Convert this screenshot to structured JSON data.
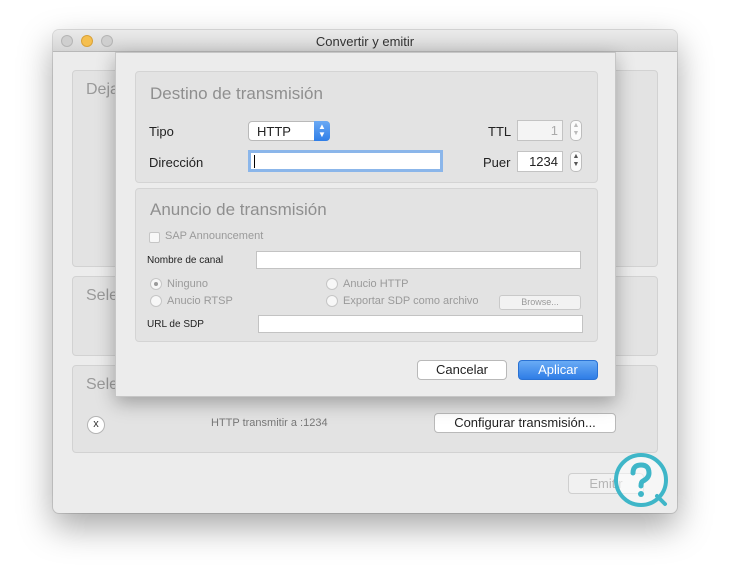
{
  "window": {
    "title": "Convertir y emitir",
    "groups": [
      "Deja",
      "Sele",
      "Sele"
    ],
    "stream_status": "HTTP transmitir a :1234",
    "configure_label": "Configurar transmisión...",
    "remove_label": "x",
    "emit_label": "Emitir"
  },
  "dialog": {
    "destination": {
      "title": "Destino de transmisión",
      "type_label": "Tipo",
      "type_value": "HTTP",
      "address_label": "Dirección",
      "address_value": "",
      "ttl_label": "TTL",
      "ttl_value": "1",
      "port_label": "Puer",
      "port_value": "1234"
    },
    "announce": {
      "title": "Anuncio de transmisión",
      "sap_label": "SAP Announcement",
      "sap_checked": false,
      "channel_label": "Nombre de canal",
      "channel_value": "",
      "options": [
        "Ninguno",
        "Anucio HTTP",
        "Anucio RTSP",
        "Exportar SDP como archivo"
      ],
      "selected_option": "Ninguno",
      "browse_label": "Browse...",
      "sdp_url_label": "URL de SDP",
      "sdp_url_value": ""
    },
    "cancel_label": "Cancelar",
    "apply_label": "Aplicar"
  },
  "colors": {
    "accent": "#2f7de6",
    "focus_ring": "#8bb6ea",
    "minimize": "#f5bf4f",
    "watermark": "#3fb6c8"
  }
}
